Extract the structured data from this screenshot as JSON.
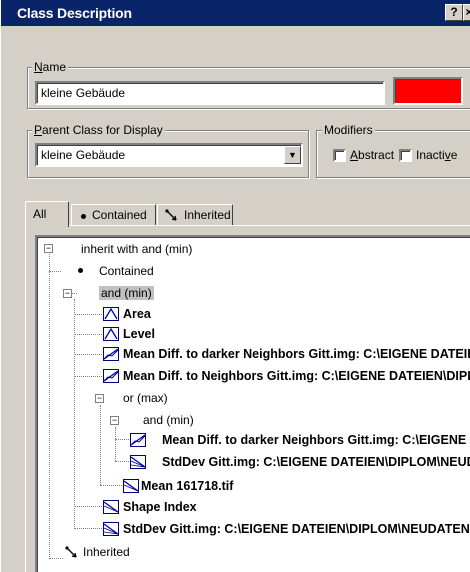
{
  "window": {
    "title": "Class Description",
    "help_label": "?",
    "close_label": "×"
  },
  "name_group": {
    "legend_u": "N",
    "legend_rest": "ame",
    "value": "kleine Gebäude",
    "color": "#ff0000"
  },
  "parent_group": {
    "legend_u": "P",
    "legend_rest": "arent Class for Display",
    "value": "kleine Gebäude",
    "arrow": "▼"
  },
  "modifiers_group": {
    "legend": "Modifiers",
    "abstract_u": "A",
    "abstract_rest": "bstract",
    "inactive_pre": "Inacti",
    "inactive_u": "v",
    "inactive_post": "e"
  },
  "tabs": [
    {
      "label": "All"
    },
    {
      "label": "Contained"
    },
    {
      "label": "Inherited"
    }
  ],
  "tree": {
    "root": "inherit with and (min)",
    "contained": "Contained",
    "and_min": "and (min)",
    "area": "Area",
    "level": "Level",
    "mean_diff_darker": "Mean Diff. to darker Neighbors Gitt.img:  C:\\EIGENE DATEIEN\\DIPLOM\\NEUDATEN",
    "mean_diff_neighbors": "Mean Diff. to Neighbors Gitt.img:  C:\\EIGENE DATEIEN\\DIPLOM\\NEUDATEN",
    "or_max": "or (max)",
    "and_min_2": "and (min)",
    "mean_diff_darker_2": "Mean Diff. to darker Neighbors Gitt.img:  C:\\EIGENE DATEIEN\\DIPLOM\\NEUDATEN",
    "stddev_1": "StdDev Gitt.img:  C:\\EIGENE DATEIEN\\DIPLOM\\NEUDATEN",
    "mean_161718": "Mean 161718.tif",
    "shape_index": "Shape Index",
    "stddev_2": "StdDev Gitt.img:  C:\\EIGENE DATEIEN\\DIPLOM\\NEUDATEN",
    "inherited": "Inherited",
    "expander_label": "−"
  }
}
